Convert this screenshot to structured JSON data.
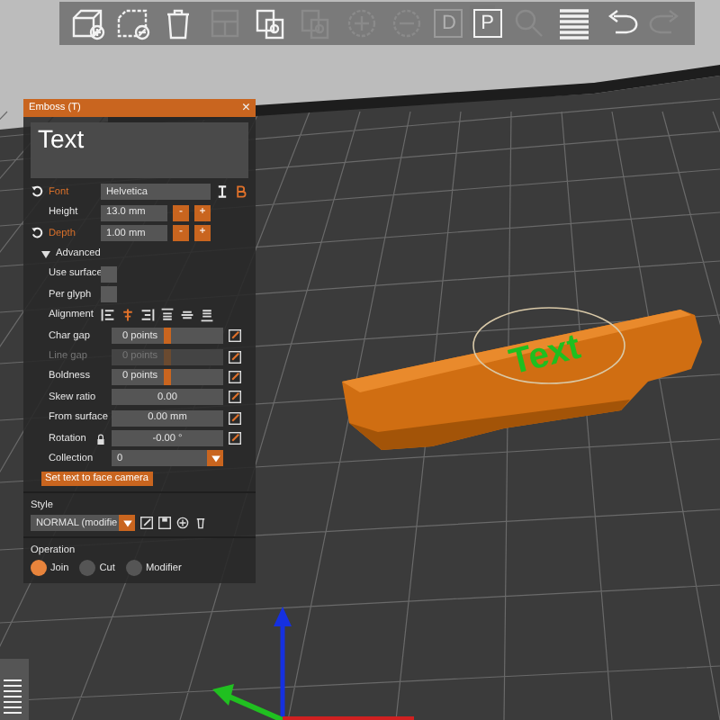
{
  "toolbar": [
    {
      "kind": "add",
      "disabled": false
    },
    {
      "kind": "remove",
      "disabled": false
    },
    {
      "kind": "delete",
      "disabled": false
    },
    {
      "kind": "arrange",
      "disabled": true
    },
    {
      "kind": "copy",
      "disabled": false
    },
    {
      "kind": "paste",
      "disabled": true
    },
    {
      "kind": "plus",
      "disabled": true
    },
    {
      "kind": "minus",
      "disabled": true
    },
    {
      "kind": "letter",
      "label": "D",
      "disabled": true
    },
    {
      "kind": "letter",
      "label": "P",
      "disabled": false
    },
    {
      "kind": "search",
      "disabled": true
    },
    {
      "kind": "layers",
      "disabled": false
    },
    {
      "kind": "undo",
      "disabled": false
    },
    {
      "kind": "redo",
      "disabled": true
    }
  ],
  "emboss": {
    "title": "Emboss (T)",
    "close": "×",
    "text": "Text",
    "font": {
      "label": "Font",
      "value": "Helvetica"
    },
    "height": {
      "label": "Height",
      "value": "13.0 mm",
      "minus": "-",
      "plus": "+"
    },
    "depth": {
      "label": "Depth",
      "value": "1.00 mm",
      "minus": "-",
      "plus": "+"
    },
    "advanced": {
      "label": "Advanced",
      "expanded": true
    },
    "checks": [
      {
        "label": "Use surface",
        "checked": false
      },
      {
        "label": "Per glyph",
        "checked": false
      }
    ],
    "alignment": {
      "label": "Alignment",
      "options": [
        {
          "kind": "left",
          "selected": false
        },
        {
          "kind": "center",
          "selected": true
        },
        {
          "kind": "right",
          "selected": false
        },
        {
          "kind": "top",
          "selected": false
        },
        {
          "kind": "middle",
          "selected": false
        },
        {
          "kind": "bottom",
          "selected": false
        }
      ]
    },
    "sliders": [
      {
        "label": "Char gap",
        "value": "0 points",
        "disabled": false,
        "level": 0.5
      },
      {
        "label": "Line gap",
        "value": "0 points",
        "disabled": true,
        "level": 0.5
      },
      {
        "label": "Boldness",
        "value": "0 points",
        "disabled": false,
        "level": 0.5
      },
      {
        "label": "Skew ratio",
        "value": "0.00",
        "disabled": false
      },
      {
        "label": "From surface",
        "value": "0.00 mm",
        "disabled": false
      },
      {
        "label": "Rotation",
        "value": "-0.00 °",
        "disabled": false,
        "lock": true
      }
    ],
    "collection": {
      "label": "Collection",
      "value": "0"
    },
    "face_camera": "Set text to face camera",
    "style": {
      "label": "Style",
      "value": "NORMAL (modifie"
    },
    "operation": {
      "label": "Operation",
      "options": [
        {
          "label": "Join",
          "selected": true
        },
        {
          "label": "Cut",
          "selected": false
        },
        {
          "label": "Modifier",
          "selected": false
        }
      ]
    }
  },
  "scene": {
    "model_text": "Text"
  }
}
